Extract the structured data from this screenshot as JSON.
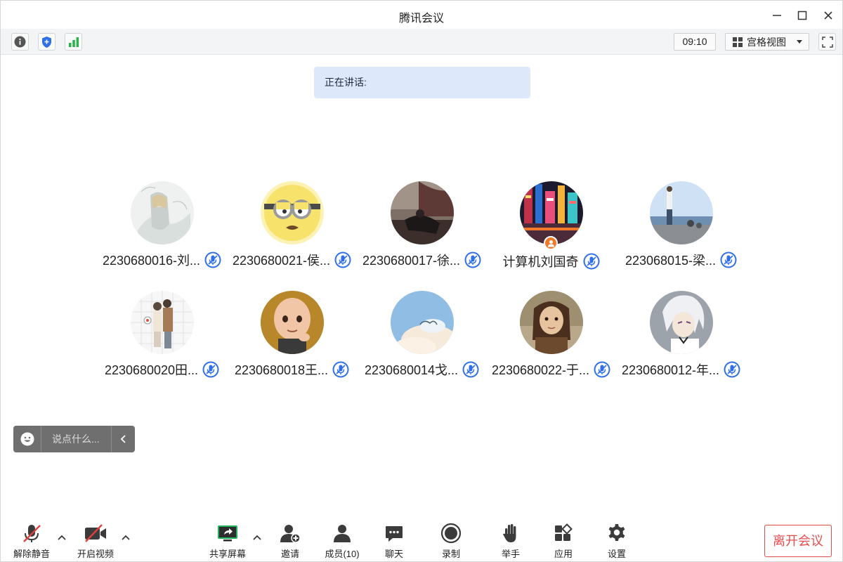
{
  "window": {
    "title": "腾讯会议"
  },
  "toolbar": {
    "clock": "09:10",
    "view_label": "宫格视图"
  },
  "speaking": {
    "label": "正在讲话:"
  },
  "participants": [
    {
      "name": "2230680016-刘...",
      "avatar": "sketch-girl"
    },
    {
      "name": "2230680021-侯...",
      "avatar": "minion"
    },
    {
      "name": "2230680017-徐...",
      "avatar": "dark-room"
    },
    {
      "name": "计算机刘国奇",
      "avatar": "neon-city",
      "host": true
    },
    {
      "name": "223068015-梁...",
      "avatar": "seaside"
    },
    {
      "name": "2230680020田...",
      "avatar": "couple-sketch"
    },
    {
      "name": "2230680018王...",
      "avatar": "bald-cartoon"
    },
    {
      "name": "2230680014戈...",
      "avatar": "sky-clouds"
    },
    {
      "name": "2230680022-于...",
      "avatar": "classic-painting"
    },
    {
      "name": "2230680012-年...",
      "avatar": "anime-boy"
    }
  ],
  "chat": {
    "placeholder": "说点什么..."
  },
  "bottom": {
    "unmute": "解除静音",
    "video": "开启视频",
    "share": "共享屏幕",
    "invite": "邀请",
    "members": "成员(10)",
    "chat": "聊天",
    "record": "录制",
    "raise_hand": "举手",
    "apps": "应用",
    "settings": "设置",
    "leave": "离开会议"
  },
  "colors": {
    "accent_blue": "#2f6fe8",
    "banner_bg": "#dde9fb",
    "leave_red": "#e54d4d",
    "host_orange": "#f07a2a",
    "signal_green": "#2bb24c"
  }
}
